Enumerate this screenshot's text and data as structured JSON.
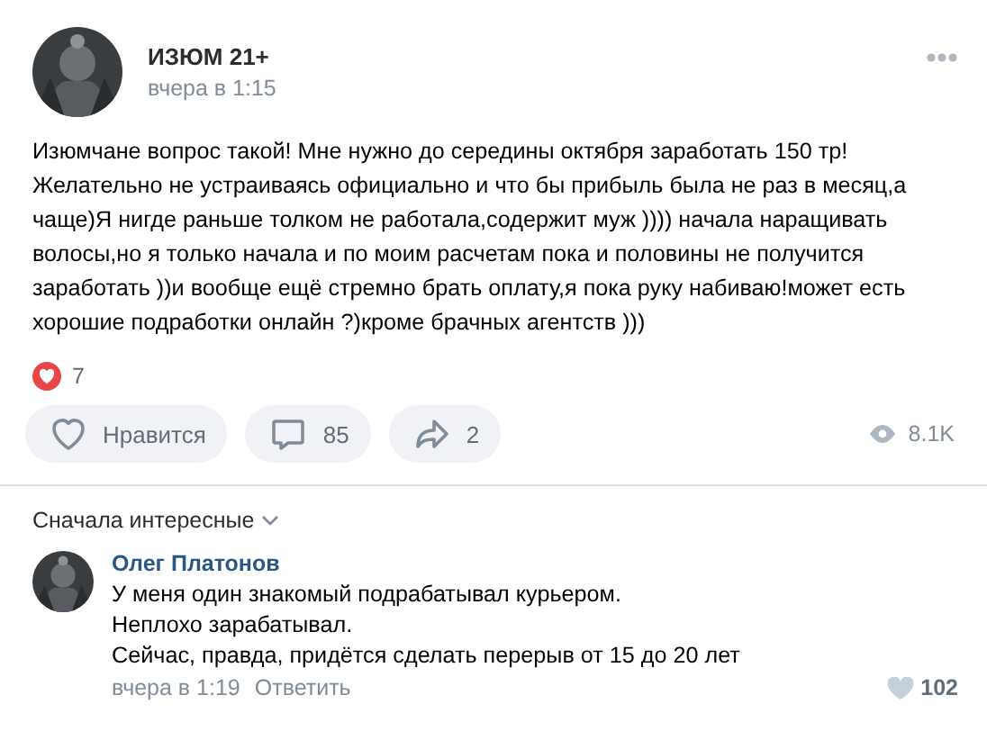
{
  "post": {
    "author": "ИЗЮМ 21+",
    "time": "вчера в 1:15",
    "text": "Изюмчане вопрос такой! Мне нужно до середины октября заработать 150 тр! Желательно не устраиваясь официально и что бы прибыль была не раз в месяц,а чаще)Я нигде раньше толком не работала,содержит муж )))) начала наращивать волосы,но я только начала и по моим расчетам пока и половины не получится заработать ))и вообще ещё стремно брать оплату,я пока руку набиваю!может есть хорошие подработки онлайн ?)кроме брачных агентств )))",
    "reactions_count": "7"
  },
  "actions": [
    {
      "kind": "like",
      "label": "Нравится"
    },
    {
      "kind": "comment",
      "label": "85"
    },
    {
      "kind": "share",
      "label": "2"
    }
  ],
  "views": "8.1K",
  "sort": "Сначала интересные",
  "comments": [
    {
      "author": "Олег Платонов",
      "lines": [
        "У меня один знакомый подрабатывал курьером.",
        "Неплохо зарабатывал.",
        "Сейчас, правда, придётся сделать перерыв от 15 до 20 лет"
      ],
      "time": "вчера в 1:19",
      "reply": "Ответить",
      "likes": "102"
    }
  ]
}
